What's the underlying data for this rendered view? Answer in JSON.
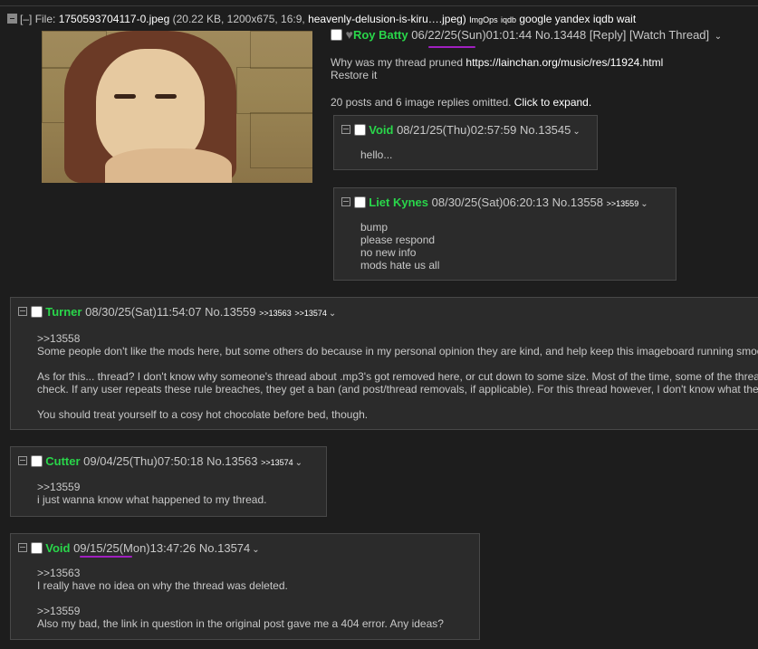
{
  "file_bar": {
    "collapse": "[–]",
    "label": "File:",
    "filename": "1750593704117-0.jpeg",
    "meta": "(20.22 KB, 1200x675, 16:9,",
    "original_name": "heavenly-delusion-is-kiru….jpeg)",
    "imgops": "ImgOps",
    "iqdb_small": "iqdb",
    "links": [
      "google",
      "yandex",
      "iqdb",
      "wait"
    ]
  },
  "op": {
    "name": "Roy Batty",
    "date": "06/22/25",
    "time": "(Sun)01:01:44",
    "no": "No.13448",
    "reply": "[Reply]",
    "watch": "[Watch Thread]",
    "body_lines": [
      "Why was my thread pruned"
    ],
    "link": "https://lainchan.org/music/res/11924.html",
    "restore": "Restore it",
    "omitted": "20 posts and 6 image replies omitted.",
    "expand": "Click to expand."
  },
  "replies": [
    {
      "name": "Void",
      "datetime": "08/21/25(Thu)02:57:59",
      "no": "No.13545",
      "refs": [],
      "lines": [
        "hello..."
      ]
    },
    {
      "name": "Liet Kynes",
      "datetime": "08/30/25(Sat)06:20:13",
      "no": "No.13558",
      "refs": [
        ">>13559"
      ],
      "lines": [
        "bump",
        "please respond",
        "no new info",
        "mods hate us all"
      ]
    },
    {
      "name": "Turner",
      "datetime": "08/30/25(Sat)11:54:07",
      "no": "No.13559",
      "refs": [
        ">>13563",
        ">>13574"
      ],
      "lines": [
        ">>13558",
        "Some people don't like the mods here, but some others do because in my personal opinion they are kind, and help keep this imageboard running smoo",
        "",
        "As for this... thread? I don't know why someone's thread about .mp3's got removed here, or cut down to some size. Most of the time, some of the threa",
        "check. If any user repeats these rule breaches, they get a ban (and post/thread removals, if applicable). For this thread however, I don't know what the",
        "",
        "You should treat yourself to a cosy hot chocolate before bed, though."
      ]
    },
    {
      "name": "Cutter",
      "datetime": "09/04/25(Thu)07:50:18",
      "no": "No.13563",
      "refs": [
        ">>13574"
      ],
      "lines": [
        ">>13559",
        "i just wanna know what happened to my thread."
      ]
    },
    {
      "name": "Void",
      "date": "09/15/25",
      "time": "(Mon)13:47:26",
      "no": "No.13574",
      "refs": [],
      "lines": [
        ">>13563",
        "I really have no idea on why the thread was deleted.",
        "",
        ">>13559",
        "Also my bad, the link in question in the original post gave me a 404 error. Any ideas?"
      ]
    }
  ],
  "colors": {
    "background": "#1d1d1d",
    "reply_bg": "#2b2b2b",
    "name": "#29d64a",
    "underline_mark": "#a020c0"
  }
}
